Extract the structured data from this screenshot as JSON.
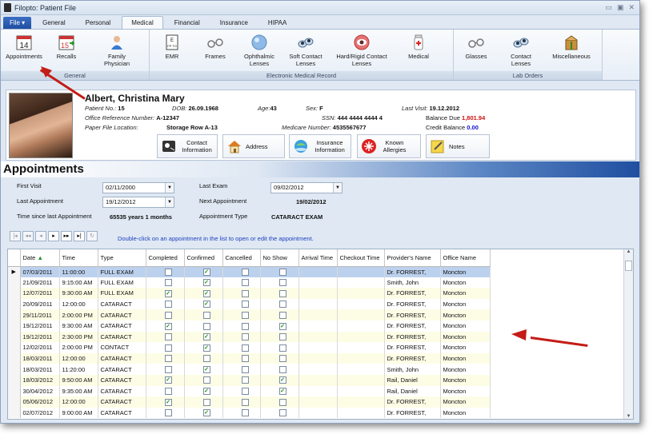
{
  "window": {
    "title": "Filopto: Patient File"
  },
  "tabs": [
    "File",
    "General",
    "Personal",
    "Medical",
    "Financial",
    "Insurance",
    "HIPAA"
  ],
  "ribbon": {
    "groups": [
      {
        "label": "General",
        "buttons": [
          "Appointments",
          "Recalls",
          "Family Physician"
        ]
      },
      {
        "label": "Electronic Medical Record",
        "buttons": [
          "EMR",
          "Frames",
          "Ophthalmic Lenses",
          "Soft Contact Lenses",
          "Hard/Rigid Contact Lenses",
          "Medical"
        ]
      },
      {
        "label": "Lab Orders",
        "buttons": [
          "Glasses",
          "Contact Lenses",
          "Miscellaneous"
        ]
      }
    ],
    "icon_text": {
      "appointments": "14",
      "recalls": "15"
    }
  },
  "patient": {
    "name": "Albert, Christina Mary",
    "patient_no_label": "Patient No.:",
    "patient_no": "15",
    "dob_label": "DOB:",
    "dob": "26.09.1968",
    "age_label": "Age:",
    "age": "43",
    "sex_label": "Sex:",
    "sex": "F",
    "last_visit_label": "Last Visit:",
    "last_visit": "19.12.2012",
    "office_ref_label": "Office Reference Number:",
    "office_ref": "A-12347",
    "ssn_label": "SSN:",
    "ssn": "444 4444 4444 4",
    "balance_due_label": "Balance Due",
    "balance_due": "1,801.94",
    "paper_file_label": "Paper File Location:",
    "paper_file": "Storage Row A-13",
    "medicare_label": "Medicare Number:",
    "medicare": "4535567677",
    "credit_balance_label": "Credit Balance",
    "credit_balance": "0.00",
    "buttons": [
      "Contact Information",
      "Address",
      "Insurance Information",
      "Known Allergies",
      "Notes"
    ]
  },
  "section_title": "Appointments",
  "summary": {
    "first_visit_label": "First Visit",
    "first_visit": "02/11/2000",
    "last_exam_label": "Last Exam",
    "last_exam": "09/02/2012",
    "last_appt_label": "Last Appointment",
    "last_appt": "19/12/2012",
    "next_appt_label": "Next Appointment",
    "next_appt": "19/02/2012",
    "time_since_label": "Time since last Appointment",
    "time_since": "65535 years  1 months",
    "appt_type_label": "Appointment Type",
    "appt_type": "CATARACT EXAM"
  },
  "hint": "Double-click on an appointment in the list to open or edit the appointment.",
  "grid": {
    "columns": [
      "Date",
      "Time",
      "Type",
      "Completed",
      "Confirmed",
      "Cancelled",
      "No Show",
      "Arrival Time",
      "Checkout Time",
      "Provider's Name",
      "Office Name"
    ],
    "rows": [
      {
        "date": "07/03/2011",
        "time": "11:00:00",
        "type": "FULL EXAM",
        "completed": false,
        "confirmed": true,
        "cancelled": false,
        "noshow": false,
        "provider": "Dr. FORREST,",
        "office": "Moncton"
      },
      {
        "date": "21/09/2011",
        "time": "9:15:00 AM",
        "type": "FULL EXAM",
        "completed": false,
        "confirmed": true,
        "cancelled": false,
        "noshow": false,
        "provider": "Smith, John",
        "office": "Moncton"
      },
      {
        "date": "12/07/2011",
        "time": "9:30:00 AM",
        "type": "FULL EXAM",
        "completed": true,
        "confirmed": true,
        "cancelled": false,
        "noshow": false,
        "provider": "Dr. FORREST,",
        "office": "Moncton"
      },
      {
        "date": "20/09/2011",
        "time": "12:00:00",
        "type": "CATARACT",
        "completed": false,
        "confirmed": true,
        "cancelled": false,
        "noshow": false,
        "provider": "Dr. FORREST,",
        "office": "Moncton"
      },
      {
        "date": "29/11/2011",
        "time": "2:00:00 PM",
        "type": "CATARACT",
        "completed": false,
        "confirmed": false,
        "cancelled": false,
        "noshow": false,
        "provider": "Dr. FORREST,",
        "office": "Moncton"
      },
      {
        "date": "19/12/2011",
        "time": "9:30:00 AM",
        "type": "CATARACT",
        "completed": true,
        "confirmed": false,
        "cancelled": false,
        "noshow": true,
        "provider": "Dr. FORREST,",
        "office": "Moncton"
      },
      {
        "date": "19/12/2011",
        "time": "2:30:00 PM",
        "type": "CATARACT",
        "completed": false,
        "confirmed": true,
        "cancelled": false,
        "noshow": false,
        "provider": "Dr. FORREST,",
        "office": "Moncton"
      },
      {
        "date": "12/02/2011",
        "time": "2:00:00 PM",
        "type": "CONTACT",
        "completed": false,
        "confirmed": true,
        "cancelled": false,
        "noshow": false,
        "provider": "Dr. FORREST,",
        "office": "Moncton"
      },
      {
        "date": "18/03/2011",
        "time": "12:00:00",
        "type": "CATARACT",
        "completed": false,
        "confirmed": false,
        "cancelled": false,
        "noshow": false,
        "provider": "Dr. FORREST,",
        "office": "Moncton"
      },
      {
        "date": "18/03/2011",
        "time": "11:20:00",
        "type": "CATARACT",
        "completed": false,
        "confirmed": true,
        "cancelled": false,
        "noshow": false,
        "provider": "Smith, John",
        "office": "Moncton"
      },
      {
        "date": "18/03/2012",
        "time": "9:50:00 AM",
        "type": "CATARACT",
        "completed": true,
        "confirmed": false,
        "cancelled": false,
        "noshow": true,
        "provider": "Rail, Daniel",
        "office": "Moncton"
      },
      {
        "date": "30/04/2012",
        "time": "9:35:00 AM",
        "type": "CATARACT",
        "completed": false,
        "confirmed": true,
        "cancelled": false,
        "noshow": true,
        "provider": "Rail, Daniel",
        "office": "Moncton"
      },
      {
        "date": "05/06/2012",
        "time": "12:00:00",
        "type": "CATARACT",
        "completed": true,
        "confirmed": false,
        "cancelled": false,
        "noshow": false,
        "provider": "Dr. FORREST,",
        "office": "Moncton"
      },
      {
        "date": "02/07/2012",
        "time": "9:00:00 AM",
        "type": "CATARACT",
        "completed": false,
        "confirmed": true,
        "cancelled": false,
        "noshow": false,
        "provider": "Dr. FORREST,",
        "office": "Moncton"
      }
    ]
  },
  "colors": {
    "accent": "#1f4ea0",
    "balance_due": "#d01010",
    "credit_balance": "#1010d0",
    "annotation_arrow": "#c41c16",
    "row_alt": "#fdfde6",
    "row_selected": "#bcd1ee"
  }
}
